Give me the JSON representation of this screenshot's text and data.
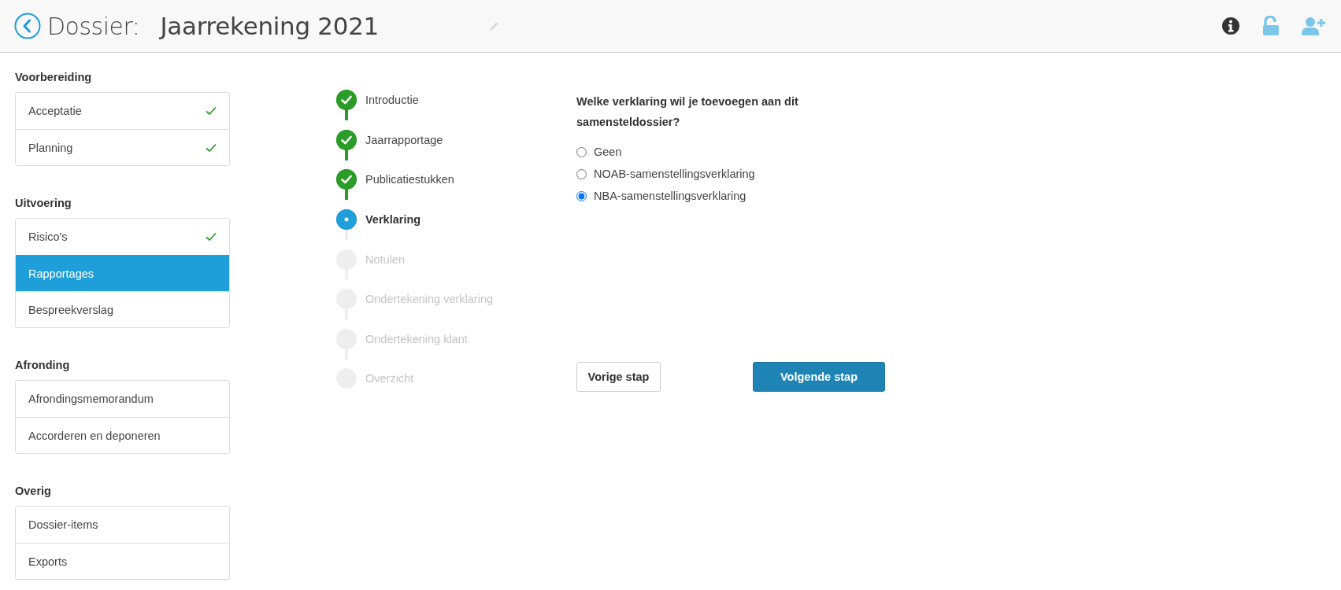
{
  "header": {
    "label": "Dossier:",
    "title": "Jaarrekening 2021"
  },
  "sidebar": {
    "groups": [
      {
        "title": "Voorbereiding",
        "items": [
          {
            "label": "Acceptatie",
            "done": true,
            "selected": false
          },
          {
            "label": "Planning",
            "done": true,
            "selected": false
          }
        ]
      },
      {
        "title": "Uitvoering",
        "items": [
          {
            "label": "Risico's",
            "done": true,
            "selected": false
          },
          {
            "label": "Rapportages",
            "done": false,
            "selected": true
          },
          {
            "label": "Bespreekverslag",
            "done": false,
            "selected": false
          }
        ]
      },
      {
        "title": "Afronding",
        "items": [
          {
            "label": "Afrondingsmemorandum",
            "done": false,
            "selected": false
          },
          {
            "label": "Accorderen en deponeren",
            "done": false,
            "selected": false
          }
        ]
      },
      {
        "title": "Overig",
        "items": [
          {
            "label": "Dossier-items",
            "done": false,
            "selected": false
          },
          {
            "label": "Exports",
            "done": false,
            "selected": false
          }
        ]
      }
    ]
  },
  "steps": [
    {
      "label": "Introductie",
      "kind": "done"
    },
    {
      "label": "Jaarrapportage",
      "kind": "done"
    },
    {
      "label": "Publicatiestukken",
      "kind": "done"
    },
    {
      "label": "Verklaring",
      "kind": "current"
    },
    {
      "label": "Notulen",
      "kind": "todo"
    },
    {
      "label": "Ondertekening verklaring",
      "kind": "todo"
    },
    {
      "label": "Ondertekening klant",
      "kind": "todo"
    },
    {
      "label": "Overzicht",
      "kind": "todo"
    }
  ],
  "question": {
    "text": "Welke verklaring wil je toevoegen aan dit samensteldossier?",
    "options": [
      {
        "label": "Geen",
        "selected": false
      },
      {
        "label": "NOAB-samenstellingsverklaring",
        "selected": false
      },
      {
        "label": "NBA-samenstellingsverklaring",
        "selected": true
      }
    ]
  },
  "buttons": {
    "previous": "Vorige stap",
    "next": "Volgende stap"
  }
}
